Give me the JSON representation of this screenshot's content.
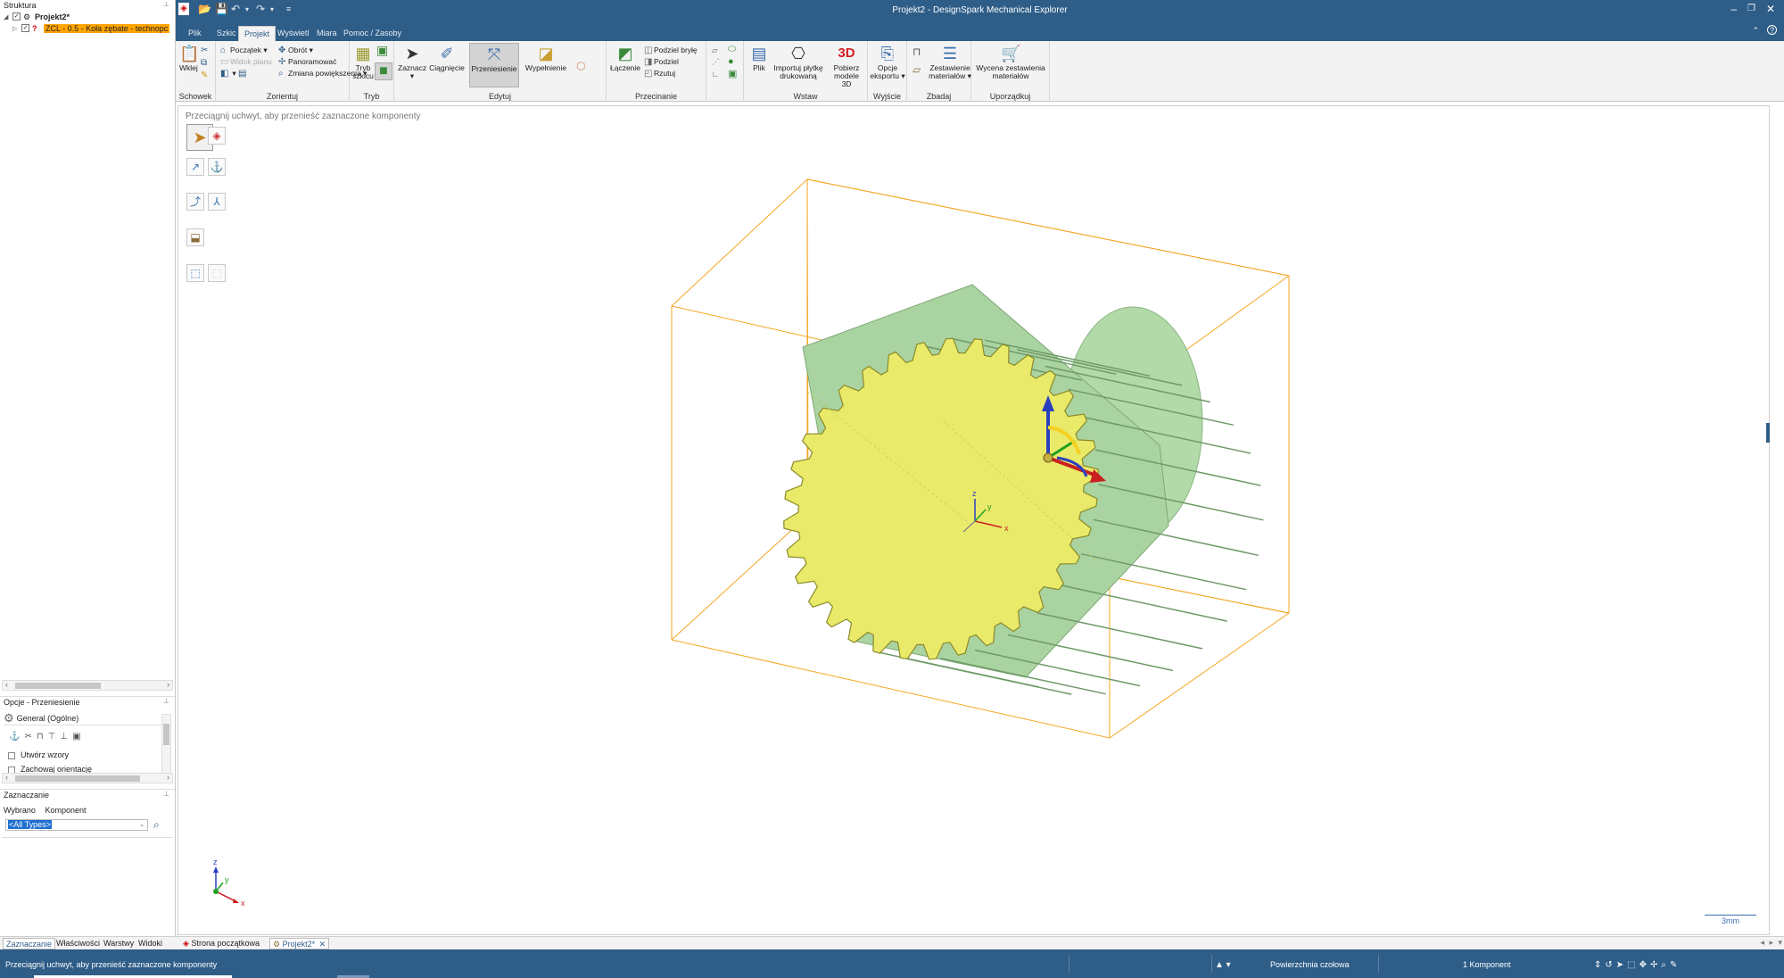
{
  "app": {
    "title": "Projekt2 - DesignSpark Mechanical Explorer"
  },
  "structure": {
    "header": "Struktura",
    "root": "Projekt2*",
    "child": "ZCL - 0.5 - Koła zębate - technopc"
  },
  "menu": {
    "tabs": [
      "Plik",
      "Szkic",
      "Projekt",
      "Wyświetl",
      "Miara",
      "Pomoc / Zasoby"
    ],
    "active": "Projekt"
  },
  "ribbon": {
    "schowek": {
      "label": "Schowek",
      "wklej": "Wklej"
    },
    "zorientuj": {
      "label": "Zorientuj",
      "poczatek": "Początek",
      "obrot": "Obrót",
      "widok_planu": "Widok planu",
      "panoramowac": "Panoramować",
      "zmiana": "Zmiana powiększenia"
    },
    "tryb": {
      "label": "Tryb",
      "tryb_szkicu": "Tryb szkicu"
    },
    "edytuj": {
      "label": "Edytuj",
      "zaznacz": "Zaznacz",
      "ciagniecie": "Ciągnięcie",
      "przeniesienie": "Przeniesienie",
      "wypelnienie": "Wypełnienie"
    },
    "przecinanie": {
      "label": "Przecinanie",
      "laczenie": "Łączenie",
      "podziel_bryle": "Podziel bryłę",
      "podziel": "Podziel",
      "rzutuj": "Rzutuj"
    },
    "wstaw": {
      "label": "Wstaw",
      "plik": "Plik",
      "importuj_1": "Importuj płytkę",
      "importuj_2": "drukowaną",
      "pobierz_1": "Pobierz modele",
      "pobierz_2": "3D"
    },
    "wyjscie": {
      "label": "Wyjście",
      "opcje_1": "Opcje",
      "opcje_2": "eksportu"
    },
    "zbadaj": {
      "label": "Zbadaj",
      "zest_1": "Zestawienie",
      "zest_2": "materiałów"
    },
    "uporzadkuj": {
      "label": "Uporządkuj",
      "wycena_1": "Wycena zestawienia",
      "wycena_2": "materiałów"
    }
  },
  "viewport": {
    "hint": "Przeciągnij uchwyt, aby przenieść zaznaczone komponenty",
    "scale": "3mm",
    "axis_z": "z",
    "axis_y": "y",
    "axis_x": "x"
  },
  "options": {
    "header": "Opcje - Przeniesienie",
    "general": "General (Ogólne)",
    "utworz": "Utwórz wzory",
    "zachowaj": "Zachowaj orientację"
  },
  "selection": {
    "header": "Zaznaczanie",
    "wybrano": "Wybrano",
    "komponent": "Komponent",
    "filter": "<All Types>"
  },
  "bottom_tabs": {
    "left": [
      "Zaznaczanie",
      "Właściwości",
      "Warstwy",
      "Widoki"
    ],
    "docs": [
      "Strona początkowa",
      "Projekt2*"
    ]
  },
  "status": {
    "message": "Przeciągnij uchwyt, aby przenieść zaznaczone komponenty",
    "face": "Powierzchnia czołowa",
    "count": "1 Komponent"
  },
  "colors": {
    "accent": "#2e5d88",
    "selection": "#ffa500",
    "gear_face": "#eaea6a",
    "gear_body": "#a9d3a0"
  }
}
